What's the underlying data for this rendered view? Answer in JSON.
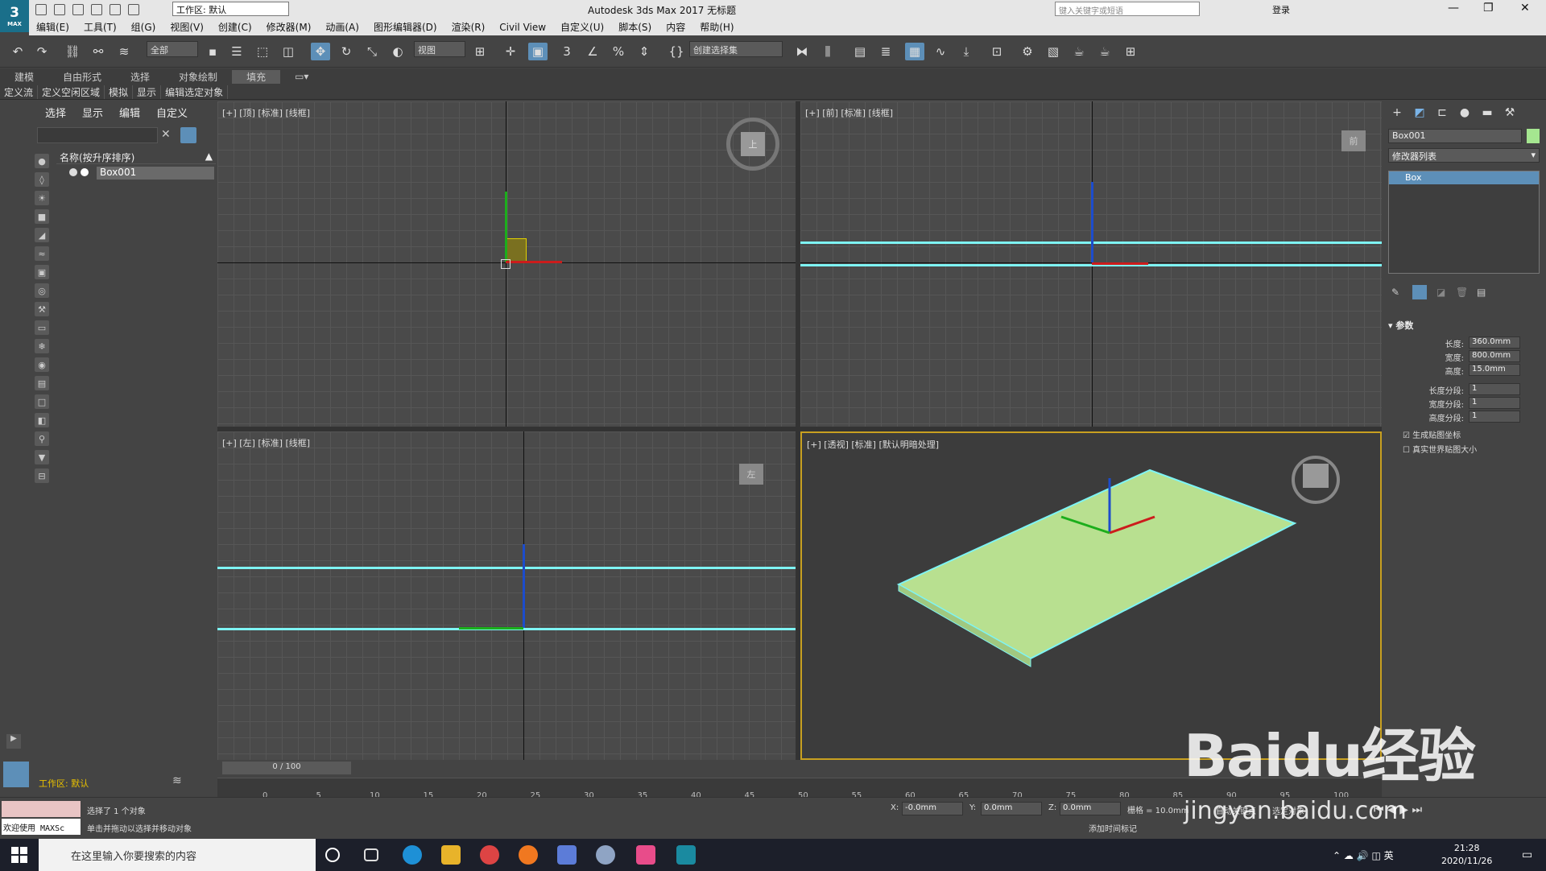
{
  "app": {
    "logo": "3",
    "logo_sub": "MAX",
    "workspace": "工作区: 默认",
    "title": "Autodesk 3ds Max 2017    无标题",
    "search_placeholder": "键入关键字或短语",
    "login": "登录"
  },
  "menu": [
    "编辑(E)",
    "工具(T)",
    "组(G)",
    "视图(V)",
    "创建(C)",
    "修改器(M)",
    "动画(A)",
    "图形编辑器(D)",
    "渲染(R)",
    "Civil View",
    "自定义(U)",
    "脚本(S)",
    "内容",
    "帮助(H)"
  ],
  "toolbar": {
    "filter": "全部",
    "coord_sys": "视图",
    "selset": "创建选择集"
  },
  "ribbon": {
    "tabs": [
      "建模",
      "自由形式",
      "选择",
      "对象绘制",
      "填充"
    ],
    "active": "填充",
    "subtabs": [
      "定义流",
      "定义空闲区域",
      "模拟",
      "显示",
      "编辑选定对象"
    ]
  },
  "scene": {
    "menu": [
      "选择",
      "显示",
      "编辑",
      "自定义"
    ],
    "header": "名称(按升序排序)",
    "object": "Box001"
  },
  "viewports": {
    "top": "[+] [顶] [标准] [线框]",
    "front": "[+] [前] [标准] [线框]",
    "left": "[+] [左] [标准] [线框]",
    "persp": "[+] [透视] [标准] [默认明暗处理]",
    "top_cube": "上",
    "front_cube": "前",
    "left_cube": "左"
  },
  "cmd": {
    "name": "Box001",
    "mod_list": "修改器列表",
    "stack_item": "Box",
    "rollout": "参数",
    "params": [
      {
        "label": "长度:",
        "value": "360.0mm"
      },
      {
        "label": "宽度:",
        "value": "800.0mm"
      },
      {
        "label": "高度:",
        "value": "15.0mm"
      },
      {
        "label": "长度分段:",
        "value": "1"
      },
      {
        "label": "宽度分段:",
        "value": "1"
      },
      {
        "label": "高度分段:",
        "value": "1"
      }
    ],
    "check1": "生成贴图坐标",
    "check2": "真实世界贴图大小"
  },
  "timeline": {
    "slider": "0 / 100",
    "ticks": [
      "0",
      "5",
      "10",
      "15",
      "20",
      "25",
      "30",
      "35",
      "40",
      "45",
      "50",
      "55",
      "60",
      "65",
      "70",
      "75",
      "80",
      "85",
      "90",
      "95",
      "100"
    ]
  },
  "status": {
    "workspace": "工作区: 默认",
    "maxscript": "欢迎使用 MAXSc",
    "sel": "选择了 1 个对象",
    "hint": "单击并拖动以选择并移动对象",
    "x": "-0.0mm",
    "y": "0.0mm",
    "z": "0.0mm",
    "grid": "栅格 = 10.0mm",
    "addtime": "添加时间标记",
    "autokey": "自动关键点",
    "setkey": "选定对象"
  },
  "taskbar": {
    "search": "在这里输入你要搜索的内容",
    "time": "21:28",
    "date": "2020/11/26",
    "lang": "英"
  },
  "watermark": {
    "brand": "Baidu经验",
    "url": "jingyan.baidu.com"
  }
}
